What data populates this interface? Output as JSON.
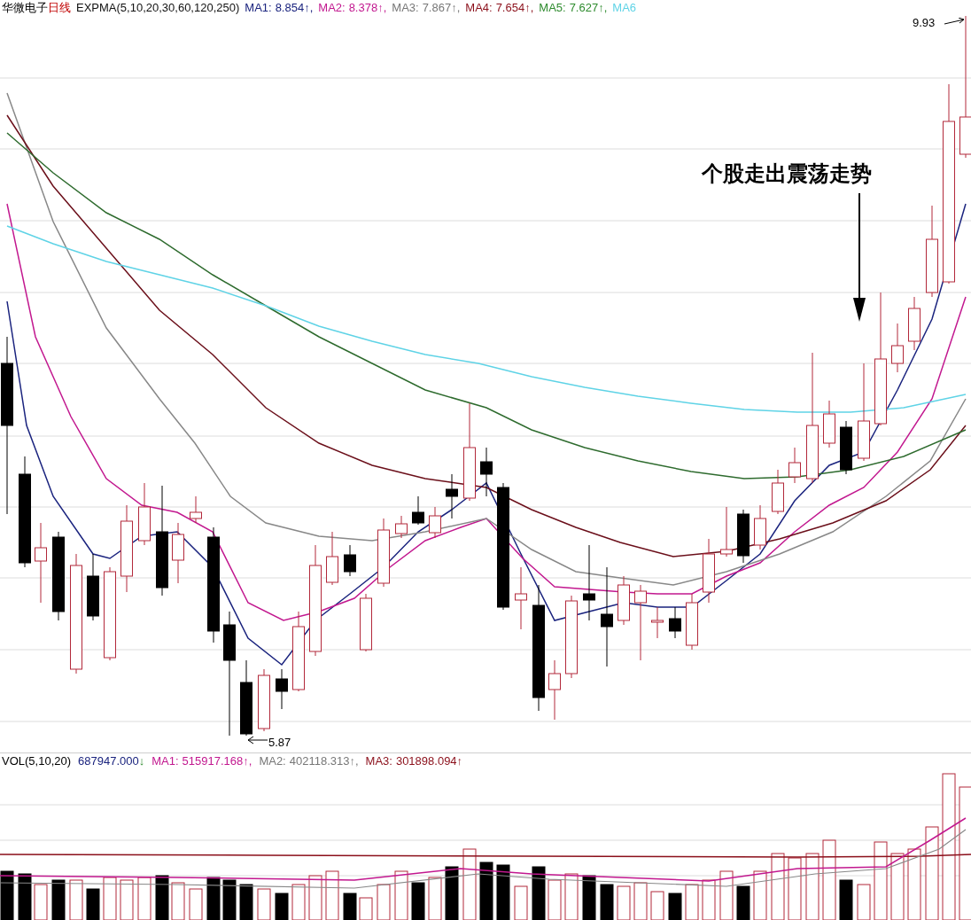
{
  "price_header": {
    "stock_name": "华微电子",
    "period": "日线",
    "indicator": "EXPMA(5,10,20,30,60,120,250)",
    "averages": [
      {
        "label": "MA1:",
        "value": "8.854↑,",
        "color": "#1a237e"
      },
      {
        "label": "MA2:",
        "value": "8.378↑,",
        "color": "#c2188f"
      },
      {
        "label": "MA3:",
        "value": "7.867↑,",
        "color": "#777777"
      },
      {
        "label": "MA4:",
        "value": "7.654↑,",
        "color": "#8b0f1a"
      },
      {
        "label": "MA5:",
        "value": "7.627↑,",
        "color": "#2e8b2e"
      },
      {
        "label": "MA6",
        "color": "#5fd3e6"
      }
    ]
  },
  "price_chart": {
    "high_label": "9.93",
    "low_label": "5.87",
    "annotation": "个股走出震荡走势"
  },
  "volume_header": {
    "indicator": "VOL(5,10,20)",
    "volume": "687947.000",
    "volume_trend": "↓",
    "averages": [
      {
        "label": "MA1:",
        "value": "515917.168↑,",
        "color": "#c2188f"
      },
      {
        "label": "MA2:",
        "value": "402118.313↑,",
        "color": "#777777"
      },
      {
        "label": "MA3:",
        "value": "301898.094↑",
        "color": "#8b0f1a"
      }
    ]
  }
}
